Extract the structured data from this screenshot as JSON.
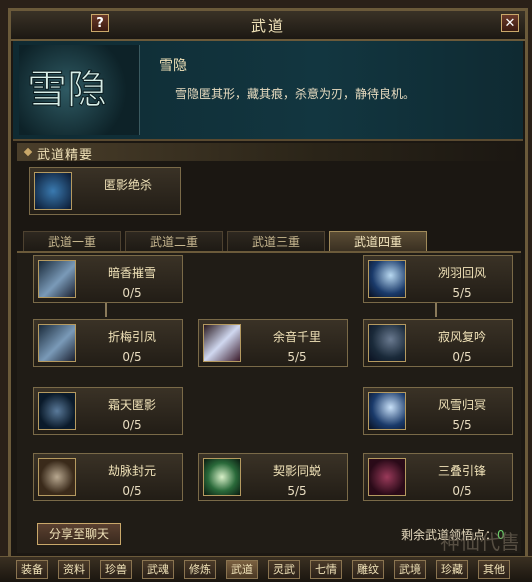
{
  "window": {
    "title": "武道",
    "help_glyph": "?",
    "close_glyph": "✕"
  },
  "selected_skill": {
    "emblem_text": "雪隐",
    "name": "雪隐",
    "description": "雪隐匿其形，藏其痕，杀意为刃，静待良机。"
  },
  "essence": {
    "header": "武道精要",
    "skill": {
      "name": "匿影绝杀",
      "icon": "shadow-kill-icon"
    }
  },
  "tabs": [
    {
      "label": "武道一重",
      "active": false
    },
    {
      "label": "武道二重",
      "active": false
    },
    {
      "label": "武道三重",
      "active": false
    },
    {
      "label": "武道四重",
      "active": true
    }
  ],
  "skills": [
    {
      "name": "暗香摧雪",
      "level": "0/5",
      "icon": "blade-icon"
    },
    {
      "name": "冽羽回风",
      "level": "5/5",
      "icon": "wind-icon"
    },
    {
      "name": "折梅引凤",
      "level": "0/5",
      "icon": "blade-icon"
    },
    {
      "name": "余音千里",
      "level": "5/5",
      "icon": "blade-icon"
    },
    {
      "name": "寂风复吟",
      "level": "0/5",
      "icon": "wind-icon"
    },
    {
      "name": "霜天匿影",
      "level": "0/5",
      "icon": "frost-icon"
    },
    {
      "name": "风雪归冥",
      "level": "5/5",
      "icon": "wind-icon"
    },
    {
      "name": "劫脉封元",
      "level": "0/5",
      "icon": "meridian-icon"
    },
    {
      "name": "契影同蜕",
      "level": "5/5",
      "icon": "vortex-icon"
    },
    {
      "name": "三叠引锋",
      "level": "0/5",
      "icon": "triple-icon"
    }
  ],
  "footer": {
    "share_label": "分享至聊天",
    "points_label": "剩余武道领悟点：",
    "points_value": "0"
  },
  "bottom_tabs": [
    {
      "label": "装备",
      "active": false
    },
    {
      "label": "资料",
      "active": false
    },
    {
      "label": "珍兽",
      "active": false
    },
    {
      "label": "武魂",
      "active": false
    },
    {
      "label": "修炼",
      "active": false
    },
    {
      "label": "武道",
      "active": true
    },
    {
      "label": "灵武",
      "active": false
    },
    {
      "label": "七情",
      "active": false
    },
    {
      "label": "雕纹",
      "active": false
    },
    {
      "label": "武境",
      "active": false
    },
    {
      "label": "珍藏",
      "active": false
    },
    {
      "label": "其他",
      "active": false
    }
  ],
  "watermark": "神仙代售"
}
